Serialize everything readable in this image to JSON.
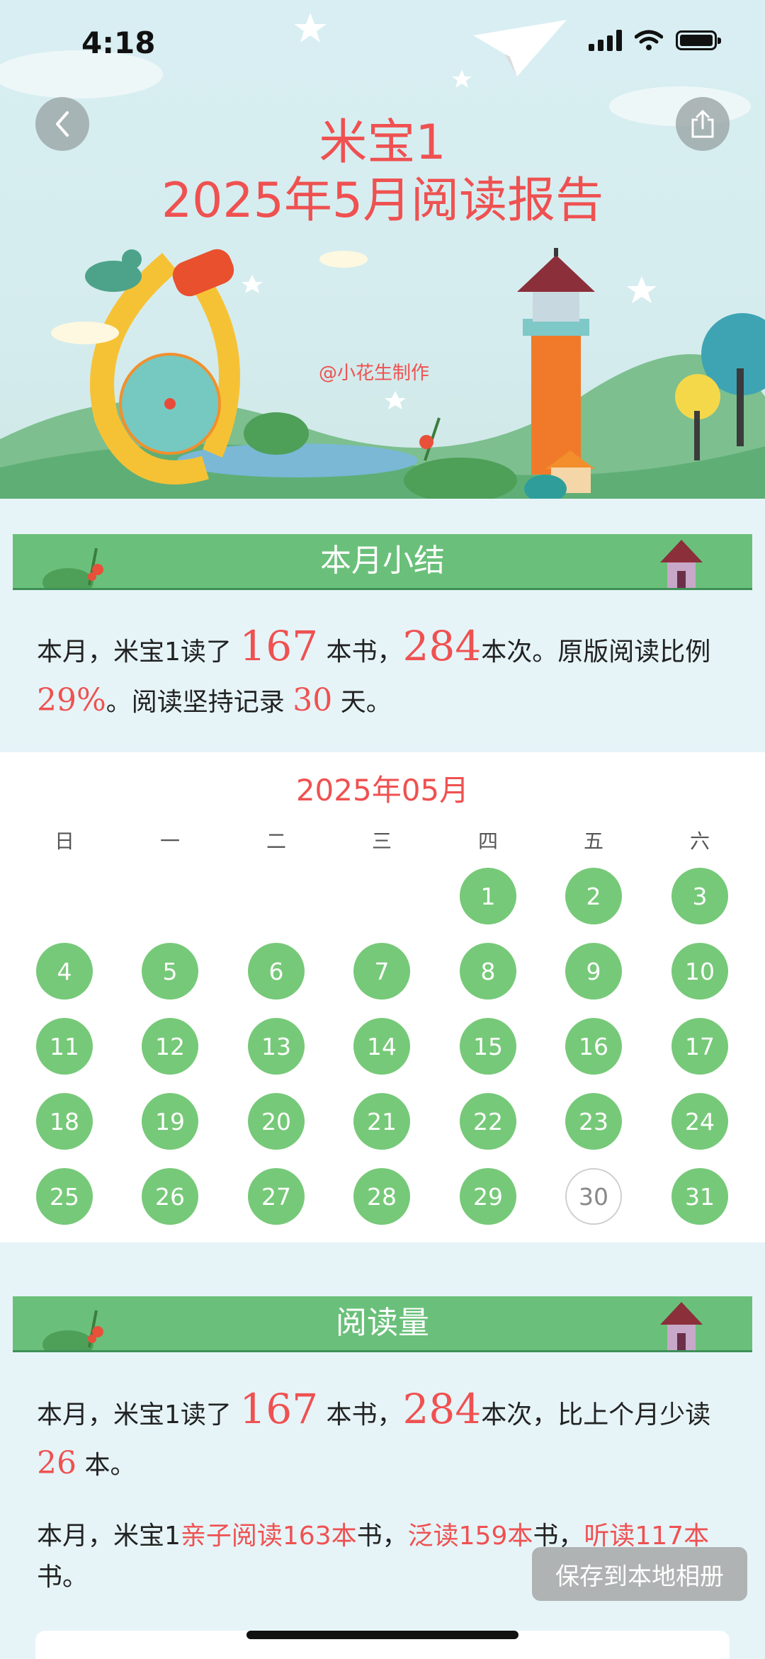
{
  "status": {
    "time": "4:18"
  },
  "header": {
    "title_line1": "米宝1",
    "title_line2": "2025年5月阅读报告",
    "maker": "@小花生制作"
  },
  "summary": {
    "heading": "本月小结",
    "p1_a": "本月，米宝1读了 ",
    "books": "167",
    "p1_b": " 本书，",
    "times": "284",
    "p1_c": "本次。原版阅读比例",
    "original_pct": "29%",
    "p1_d": "。阅读坚持记录 ",
    "streak_days": "30",
    "p1_e": " 天。"
  },
  "calendar": {
    "title": "2025年05月",
    "weekdays": [
      "日",
      "一",
      "二",
      "三",
      "四",
      "五",
      "六"
    ],
    "days": [
      "1",
      "2",
      "3",
      "4",
      "5",
      "6",
      "7",
      "8",
      "9",
      "10",
      "11",
      "12",
      "13",
      "14",
      "15",
      "16",
      "17",
      "18",
      "19",
      "20",
      "21",
      "22",
      "23",
      "24",
      "25",
      "26",
      "27",
      "28",
      "29",
      "30",
      "31"
    ]
  },
  "reading": {
    "heading": "阅读量",
    "p1_a": "本月，米宝1读了 ",
    "books": "167",
    "p1_b": " 本书，",
    "times": "284",
    "p1_c": "本次，比上个月少读",
    "less": "26",
    "p1_d": " 本。",
    "p2_a": "本月，米宝1",
    "parent": "亲子阅读163本",
    "p2_b": "书，",
    "extensive": "泛读159本",
    "p2_c": "书，",
    "listen": "听读117本",
    "p2_d": "书。"
  },
  "actions": {
    "save": "保存到本地相册"
  },
  "colors": {
    "accent_red": "#ef5151",
    "banner_green": "#6ac07a",
    "day_green": "#76c978"
  }
}
